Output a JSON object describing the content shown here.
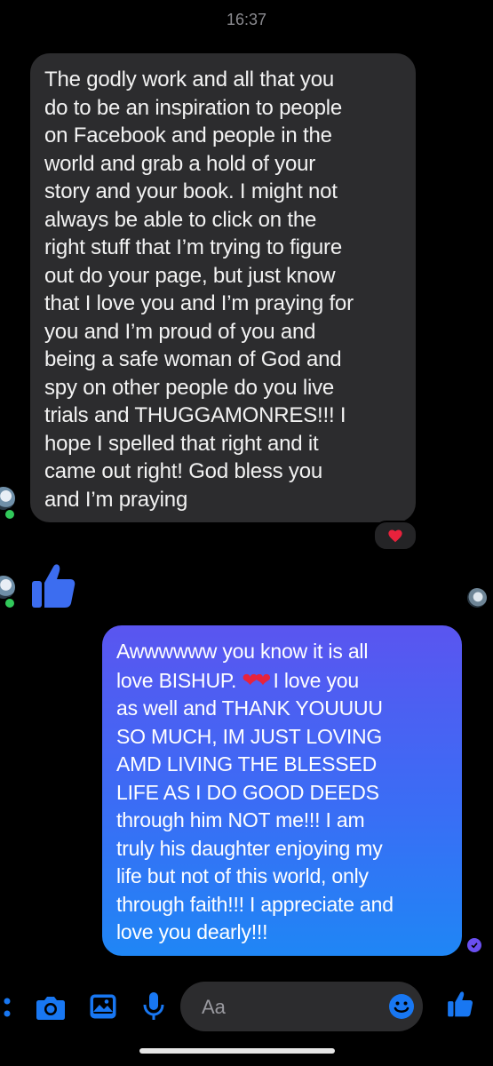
{
  "status_time": "16:37",
  "incoming_message": {
    "text": "The godly work and all that you\ndo to be an inspiration to people\non Facebook and people in the\nworld and grab a hold of your\nstory and your book. I might not\nalways be able to click on the\nright stuff that I’m trying to figure\nout do your page, but just know\nthat I love you and I’m praying for\nyou and I’m proud of you and\nbeing a safe woman of God and\nspy on other people do you live\ntrials and THUGGAMONRES!!! I\nhope I spelled that right and it\ncame out right! God bless you\nand I’m praying",
    "reaction": "heart"
  },
  "outgoing_message": {
    "text_line1_start": "Awwwwww you know it is all\nlove BISHUP. ",
    "hearts": "❤❤",
    "text_rest": " I love you\nas well and THANK YOUUUU\nSO MUCH, IM JUST LOVING\nAMD LIVING THE BLESSED\nLIFE AS I DO GOOD DEEDS\nthrough him NOT me!!! I am\ntruly his daughter enjoying my\nlife but not of this world, only\nthrough faith!!! I appreciate and\nlove you dearly!!!"
  },
  "composer": {
    "placeholder": "Aa"
  },
  "colors": {
    "accent": "#1f86f5",
    "incoming_bubble": "#2c2c2e",
    "heart": "#e8223c",
    "online": "#31c85a"
  }
}
